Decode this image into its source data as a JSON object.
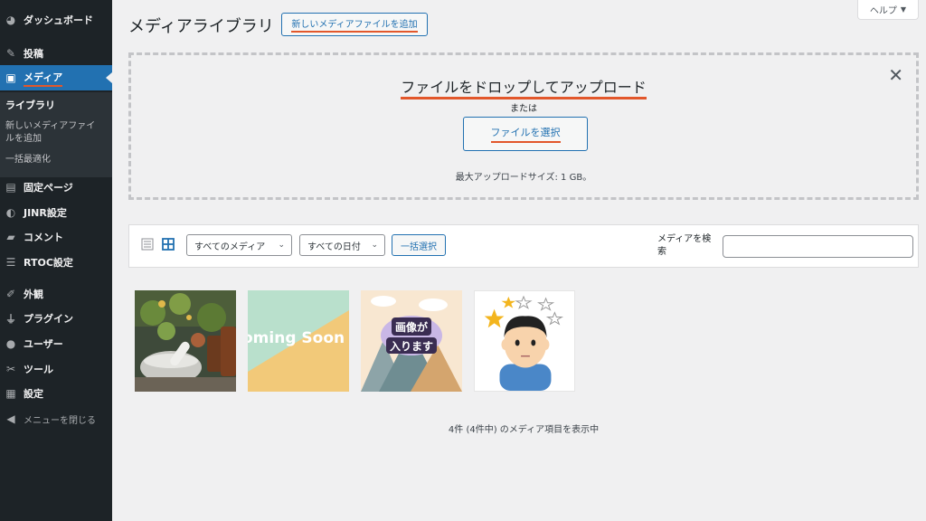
{
  "sidebar": {
    "items": [
      {
        "label": "ダッシュボード",
        "icon": "dashboard-icon"
      },
      {
        "label": "投稿",
        "icon": "pin-icon"
      },
      {
        "label": "メディア",
        "icon": "media-icon"
      },
      {
        "label": "固定ページ",
        "icon": "page-icon"
      },
      {
        "label": "JINR設定",
        "icon": "settings-icon"
      },
      {
        "label": "コメント",
        "icon": "comment-icon"
      },
      {
        "label": "RTOC設定",
        "icon": "list-icon"
      },
      {
        "label": "外観",
        "icon": "appearance-icon"
      },
      {
        "label": "プラグイン",
        "icon": "plugin-icon"
      },
      {
        "label": "ユーザー",
        "icon": "user-icon"
      },
      {
        "label": "ツール",
        "icon": "wrench-icon"
      },
      {
        "label": "設定",
        "icon": "sliders-icon"
      },
      {
        "label": "メニューを閉じる",
        "icon": "collapse-icon"
      }
    ],
    "submenu": {
      "library": "ライブラリ",
      "add_new_line1": "新しいメディアファイ",
      "add_new_line2": "ルを追加",
      "bulk_optimize": "一括最適化"
    }
  },
  "header": {
    "title": "メディアライブラリ",
    "add_new_label": "新しいメディアファイルを追加",
    "help_label": "ヘルプ"
  },
  "uploader": {
    "drop_title": "ファイルをドロップしてアップロード",
    "or_text": "または",
    "select_label": "ファイルを選択",
    "max_size": "最大アップロードサイズ: 1 GB。"
  },
  "filters": {
    "media_type": "すべてのメディア",
    "date": "すべての日付",
    "bulk_select": "一括選択",
    "search_label_line1": "メディアを検",
    "search_label_line2": "索",
    "search_value": ""
  },
  "media_items": [
    {
      "name": "herbs-photo"
    },
    {
      "name": "coming-soon-image",
      "text": "oming Soon"
    },
    {
      "name": "image-placeholder",
      "text_line1": "画像が",
      "text_line2": "入ります"
    },
    {
      "name": "confused-person-illustration"
    }
  ],
  "footer": {
    "count_text": "4件 (4件中) のメディア項目を表示中"
  },
  "colors": {
    "sidebar_bg": "#1d2327",
    "accent": "#2271b1",
    "highlight": "#e2572b",
    "page_bg": "#f0f0f1"
  }
}
